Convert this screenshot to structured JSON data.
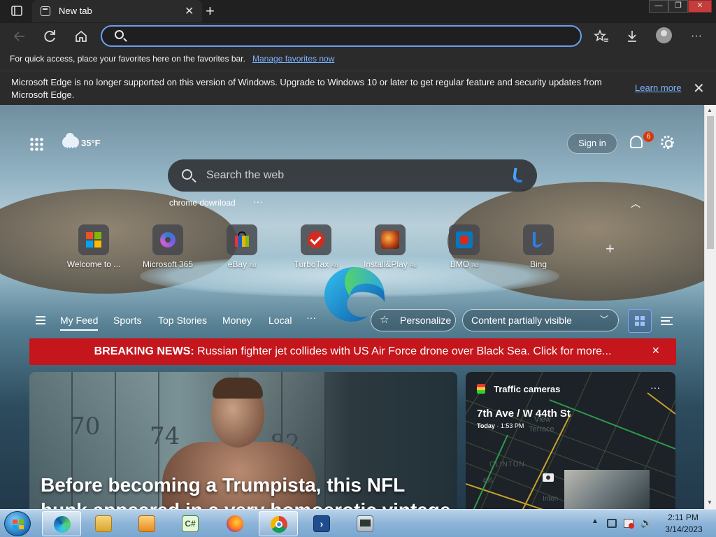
{
  "browser": {
    "tab_title": "New tab",
    "tab_close": "✕",
    "new_tab": "+",
    "window_controls": {
      "minimize": "—",
      "maximize": "❐",
      "close": "✕"
    },
    "address_value": "",
    "toolbar_more": "···"
  },
  "favorites_bar": {
    "text": "For quick access, place your favorites here on the favorites bar.",
    "link": "Manage favorites now"
  },
  "notice": {
    "text": "Microsoft Edge is no longer supported on this version of Windows. Upgrade to Windows 10 or later to get regular feature and security updates from Microsoft Edge.",
    "link": "Learn more",
    "close": "✕"
  },
  "header": {
    "weather_temp": "35°F",
    "sign_in": "Sign in",
    "notification_count": "6"
  },
  "search": {
    "placeholder": "Search the web",
    "suggestion": "chrome download",
    "more": "···"
  },
  "quick_links": [
    {
      "label": "Welcome to ...",
      "ad": "",
      "icon": "microsoft-icon"
    },
    {
      "label": "Microsoft 365",
      "ad": "",
      "icon": "microsoft-365-icon"
    },
    {
      "label": "eBay",
      "ad": "Ad",
      "icon": "ebay-icon"
    },
    {
      "label": "TurboTax",
      "ad": "Ad",
      "icon": "turbotax-icon"
    },
    {
      "label": "Install&Play",
      "ad": "Ad",
      "icon": "install-play-icon"
    },
    {
      "label": "BMO",
      "ad": "Ad",
      "icon": "bmo-icon"
    },
    {
      "label": "Bing",
      "ad": "",
      "icon": "bing-icon"
    }
  ],
  "feed": {
    "tabs": [
      "My Feed",
      "Sports",
      "Top Stories",
      "Money",
      "Local"
    ],
    "more": "···",
    "personalize": "Personalize",
    "content_visibility": "Content partially visible"
  },
  "breaking": {
    "label": "BREAKING NEWS:",
    "text": "Russian fighter jet collides with US Air Force drone over Black Sea. Click for more...",
    "close": "✕"
  },
  "hero": {
    "title": "Before becoming a Trumpista, this NFL hunk appeared in a very homoerotic vintage Gap",
    "locker_numbers": [
      "70",
      "74",
      "82"
    ]
  },
  "traffic": {
    "title": "Traffic cameras",
    "more": "···",
    "street": "7th Ave / W 44th St",
    "day": "Today",
    "time": "1:53 PM",
    "map_labels": [
      "View",
      "Terrace",
      "CLINTON",
      "495",
      "Inten"
    ]
  },
  "taskbar": {
    "apps": [
      "microsoft-edge-icon",
      "file-explorer-icon",
      "media-player-icon",
      "csharp-editor-icon",
      "firefox-icon",
      "chrome-icon",
      "powershell-icon",
      "network-monitor-icon"
    ],
    "time": "2:11 PM",
    "date": "3/14/2023"
  },
  "colors": {
    "accent_link": "#7ab1ff",
    "breaking_red": "#c4161c",
    "notification_badge": "#d4380d"
  }
}
